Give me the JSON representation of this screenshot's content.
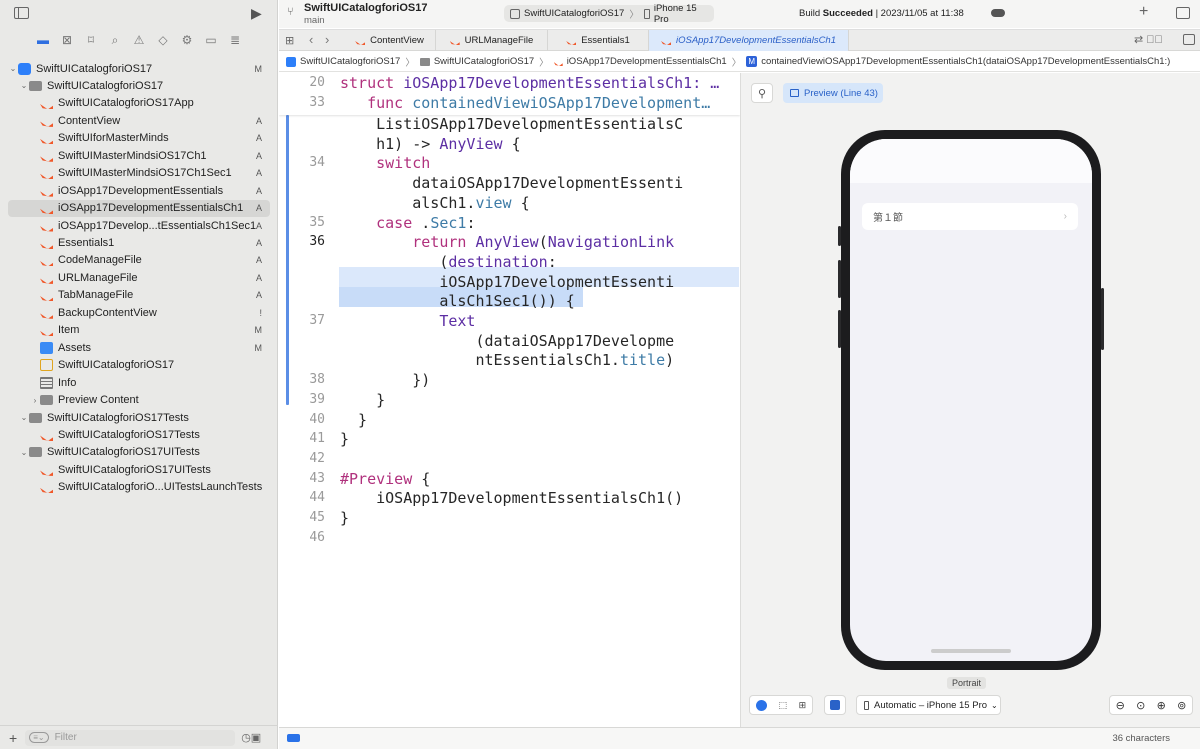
{
  "sidebar": {
    "items": [
      {
        "label": "SwiftUICatalogforiOS17",
        "badge": "M",
        "icon": "project-icon",
        "indent": 0,
        "chev": "⌄"
      },
      {
        "label": "SwiftUICatalogforiOS17",
        "badge": "",
        "icon": "folder-icon",
        "indent": 1,
        "chev": "⌄"
      },
      {
        "label": "SwiftUICatalogforiOS17App",
        "badge": "",
        "icon": "swift-icon",
        "indent": 2
      },
      {
        "label": "ContentView",
        "badge": "A",
        "icon": "swift-icon",
        "indent": 2
      },
      {
        "label": "SwiftUIforMasterMinds",
        "badge": "A",
        "icon": "swift-icon",
        "indent": 2
      },
      {
        "label": "SwiftUIMasterMindsiOS17Ch1",
        "badge": "A",
        "icon": "swift-icon",
        "indent": 2
      },
      {
        "label": "SwiftUIMasterMindsiOS17Ch1Sec1",
        "badge": "A",
        "icon": "swift-icon",
        "indent": 2
      },
      {
        "label": "iOSApp17DevelopmentEssentials",
        "badge": "A",
        "icon": "swift-icon",
        "indent": 2
      },
      {
        "label": "iOSApp17DevelopmentEssentialsCh1",
        "badge": "A",
        "icon": "swift-icon",
        "indent": 2,
        "selected": true
      },
      {
        "label": "iOSApp17Develop...tEssentialsCh1Sec1",
        "badge": "A",
        "icon": "swift-icon",
        "indent": 2
      },
      {
        "label": "Essentials1",
        "badge": "A",
        "icon": "swift-icon",
        "indent": 2
      },
      {
        "label": "CodeManageFile",
        "badge": "A",
        "icon": "swift-icon",
        "indent": 2
      },
      {
        "label": "URLManageFile",
        "badge": "A",
        "icon": "swift-icon",
        "indent": 2
      },
      {
        "label": "TabManageFile",
        "badge": "A",
        "icon": "swift-icon",
        "indent": 2
      },
      {
        "label": "BackupContentView",
        "badge": "!",
        "icon": "swift-icon",
        "indent": 2
      },
      {
        "label": "Item",
        "badge": "M",
        "icon": "swift-icon",
        "indent": 2
      },
      {
        "label": "Assets",
        "badge": "M",
        "icon": "assets-icon",
        "indent": 2
      },
      {
        "label": "SwiftUICatalogforiOS17",
        "badge": "",
        "icon": "entitlements-icon",
        "indent": 2
      },
      {
        "label": "Info",
        "badge": "",
        "icon": "plist-icon",
        "indent": 2
      },
      {
        "label": "Preview Content",
        "badge": "",
        "icon": "folder-icon",
        "indent": 2,
        "chev": "›"
      },
      {
        "label": "SwiftUICatalogforiOS17Tests",
        "badge": "",
        "icon": "folder-icon",
        "indent": 1,
        "chev": "⌄"
      },
      {
        "label": "SwiftUICatalogforiOS17Tests",
        "badge": "",
        "icon": "swift-icon",
        "indent": 2
      },
      {
        "label": "SwiftUICatalogforiOS17UITests",
        "badge": "",
        "icon": "folder-icon",
        "indent": 1,
        "chev": "⌄"
      },
      {
        "label": "SwiftUICatalogforiOS17UITests",
        "badge": "",
        "icon": "swift-icon",
        "indent": 2
      },
      {
        "label": "SwiftUICatalogforiO...UITestsLaunchTests",
        "badge": "",
        "icon": "swift-icon",
        "indent": 2
      }
    ],
    "filter_placeholder": "Filter"
  },
  "toolbar": {
    "project_name": "SwiftUICatalogforiOS17",
    "branch": "main",
    "scheme": "SwiftUICatalogforiOS17",
    "destination": "iPhone 15 Pro",
    "build_prefix": "Build ",
    "build_status": "Succeeded",
    "build_time": " | 2023/11/05 at 11:38"
  },
  "tabs": [
    {
      "label": "ContentView",
      "active": false
    },
    {
      "label": "URLManageFile",
      "active": false
    },
    {
      "label": "Essentials1",
      "active": false
    },
    {
      "label": "iOSApp17DevelopmentEssentialsCh1",
      "active": true
    }
  ],
  "jumpbar": [
    "SwiftUICatalogforiOS17",
    "SwiftUICatalogforiOS17",
    "iOSApp17DevelopmentEssentialsCh1",
    "containedViewiOSApp17DevelopmentEssentialsCh1(dataiOSApp17DevelopmentEssentialsCh1:)"
  ],
  "code": {
    "sticky1_ln": "20",
    "sticky1_kw": "struct ",
    "sticky1_name": "iOSApp17DevelopmentEssentialsCh1: …",
    "sticky2_ln": "33",
    "sticky2_kw": "func ",
    "sticky2_name": "containedViewiOSApp17Development…",
    "lines": [
      {
        "ln": "",
        "t": "    ListiOSApp17DevelopmentEssentialsC"
      },
      {
        "ln": "",
        "t": "    h1) -> AnyView {"
      },
      {
        "ln": "34",
        "t": "    switch"
      },
      {
        "ln": "",
        "t": "        dataiOSApp17DevelopmentEssenti"
      },
      {
        "ln": "",
        "t": "        alsCh1.view {"
      },
      {
        "ln": "35",
        "t": "    case .Sec1:"
      },
      {
        "ln": "36",
        "t": "        return AnyView(NavigationLink"
      },
      {
        "ln": "",
        "t": "           (destination:"
      },
      {
        "ln": "",
        "t": "           iOSApp17DevelopmentEssenti"
      },
      {
        "ln": "",
        "t": "           alsCh1Sec1()) {"
      },
      {
        "ln": "37",
        "t": "           Text"
      },
      {
        "ln": "",
        "t": "               (dataiOSApp17Developme"
      },
      {
        "ln": "",
        "t": "               ntEssentialsCh1.title)"
      },
      {
        "ln": "38",
        "t": "        })"
      },
      {
        "ln": "39",
        "t": "    }"
      },
      {
        "ln": "40",
        "t": "  }"
      },
      {
        "ln": "41",
        "t": "}"
      },
      {
        "ln": "42",
        "t": ""
      },
      {
        "ln": "43",
        "t": "#Preview {"
      },
      {
        "ln": "44",
        "t": "    iOSApp17DevelopmentEssentialsCh1()"
      },
      {
        "ln": "45",
        "t": "}"
      },
      {
        "ln": "46",
        "t": ""
      }
    ]
  },
  "canvas": {
    "preview_label": "Preview (Line 43)",
    "list_item": "第１節",
    "portrait_label": "Portrait",
    "device_menu": "Automatic – iPhone 15 Pro"
  },
  "status": {
    "characters": "36 characters"
  }
}
